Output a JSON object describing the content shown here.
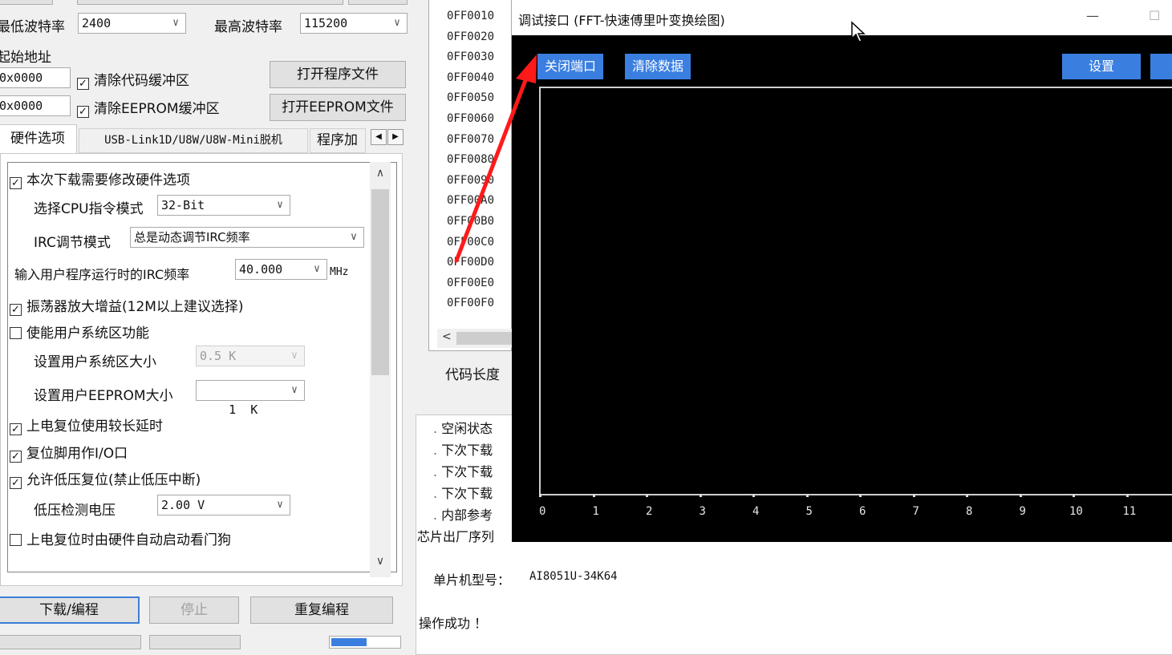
{
  "baud": {
    "min_label": "最低波特率",
    "min_value": "2400",
    "max_label": "最高波特率",
    "max_value": "115200"
  },
  "start_address": {
    "label": "起始地址",
    "code_value": "0x0000",
    "code_clear_label": "清除代码缓冲区",
    "open_program_button": "打开程序文件",
    "eeprom_value": "0x0000",
    "eeprom_clear_label": "清除EEPROM缓冲区",
    "open_eeprom_button": "打开EEPROM文件"
  },
  "tabs": [
    {
      "label": "硬件选项"
    },
    {
      "label": "USB-Link1D/U8W/U8W-Mini脱机"
    },
    {
      "label": "程序加"
    }
  ],
  "hardware": {
    "modify_label": "本次下载需要修改硬件选项",
    "cpu_mode_label": "选择CPU指令模式",
    "cpu_mode_value": "32-Bit",
    "irc_mode_label": "IRC调节模式",
    "irc_mode_value": "总是动态调节IRC频率",
    "irc_freq_label": "输入用户程序运行时的IRC频率",
    "irc_freq_value": "40.000",
    "irc_freq_unit": "MHz",
    "osc_gain_label": "振荡器放大增益(12M以上建议选择)",
    "user_sys_label": "使能用户系统区功能",
    "user_sys_size_label": "设置用户系统区大小",
    "user_sys_size_value": "0.5 K",
    "eeprom_size_label": "设置用户EEPROM大小",
    "eeprom_size_value": "1  K",
    "long_delay_label": "上电复位使用较长延时",
    "reset_io_label": "复位脚用作I/O口",
    "lvr_label": "允许低压复位(禁止低压中断)",
    "lv_detect_label": "低压检测电压",
    "lv_detect_value": "2.00 V",
    "watchdog_label": "上电复位时由硬件自动启动看门狗"
  },
  "actions": {
    "download_button": "下载/编程",
    "stop_button": "停止",
    "reprogram_button": "重复编程"
  },
  "hex_rows": [
    "0FF0010",
    "0FF0020",
    "0FF0030",
    "0FF0040",
    "0FF0050",
    "0FF0060",
    "0FF0070",
    "0FF0080",
    "0FF0090",
    "0FF00A0",
    "0FF00B0",
    "0FF00C0",
    "0FF00D0",
    "0FF00E0",
    "0FF00F0"
  ],
  "code_length_label": "代码长度",
  "log_lines": [
    "空闲状态",
    "下次下载",
    "下次下载",
    "下次下载",
    "内部参考"
  ],
  "chip_serial_label": "芯片出厂序列",
  "mcu_model_label": "单片机型号：",
  "mcu_model_value": "AI8051U-34K64",
  "result_text": "操作成功 ！",
  "dialog": {
    "title": "调试接口 (FFT-快速傅里叶变换绘图)",
    "close_port_button": "关闭端口",
    "clear_data_button": "清除数据",
    "settings_button": "设置",
    "minimize_glyph": "—",
    "maximize_glyph": "☐"
  },
  "fft_x_ticks": [
    "0",
    "1",
    "2",
    "3",
    "4",
    "5",
    "6",
    "7",
    "8",
    "9",
    "10",
    "11"
  ],
  "colors": {
    "accent_blue": "#3a7fe0",
    "plot_background": "#000000",
    "annotation_arrow": "#ff1a1a"
  }
}
